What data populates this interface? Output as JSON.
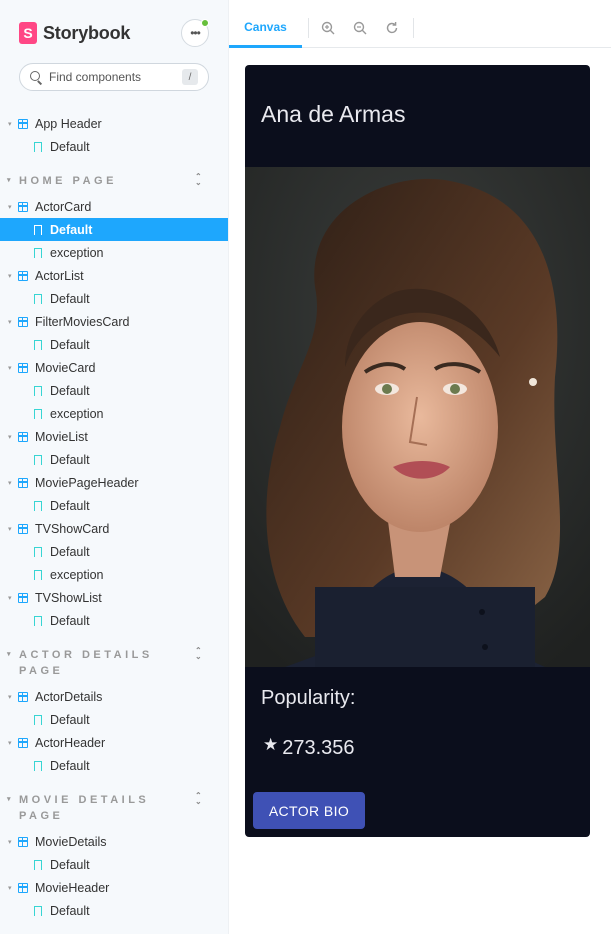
{
  "sidebar": {
    "brand": "Storybook",
    "search_placeholder": "Find components",
    "search_shortcut": "/",
    "app_header": {
      "label": "App Header",
      "stories": [
        "Default"
      ]
    },
    "groups": [
      {
        "title": "HOME PAGE",
        "components": [
          {
            "label": "ActorCard",
            "stories": [
              "Default",
              "exception"
            ]
          },
          {
            "label": "ActorList",
            "stories": [
              "Default"
            ]
          },
          {
            "label": "FilterMoviesCard",
            "stories": [
              "Default"
            ]
          },
          {
            "label": "MovieCard",
            "stories": [
              "Default",
              "exception"
            ]
          },
          {
            "label": "MovieList",
            "stories": [
              "Default"
            ]
          },
          {
            "label": "MoviePageHeader",
            "stories": [
              "Default"
            ]
          },
          {
            "label": "TVShowCard",
            "stories": [
              "Default",
              "exception"
            ]
          },
          {
            "label": "TVShowList",
            "stories": [
              "Default"
            ]
          }
        ]
      },
      {
        "title": "ACTOR DETAILS PAGE",
        "components": [
          {
            "label": "ActorDetails",
            "stories": [
              "Default"
            ]
          },
          {
            "label": "ActorHeader",
            "stories": [
              "Default"
            ]
          }
        ]
      },
      {
        "title": "MOVIE DETAILS PAGE",
        "components": [
          {
            "label": "MovieDetails",
            "stories": [
              "Default"
            ]
          },
          {
            "label": "MovieHeader",
            "stories": [
              "Default"
            ]
          }
        ]
      }
    ],
    "selected": "ActorCard/Default"
  },
  "toolbar": {
    "tab_canvas": "Canvas",
    "zoom_in_icon": "zoom-in-icon",
    "zoom_out_icon": "zoom-out-icon",
    "zoom_reset_icon": "zoom-reset-icon"
  },
  "card": {
    "name": "Ana de Armas",
    "popularity_label": "Popularity:",
    "popularity_value": "273.356",
    "star": "★",
    "button_label": "ACTOR BIO"
  },
  "colors": {
    "accent": "#1ea7fd",
    "brand": "#ff4785",
    "card_bg": "#0b0e1c",
    "button": "#3f51b5"
  }
}
